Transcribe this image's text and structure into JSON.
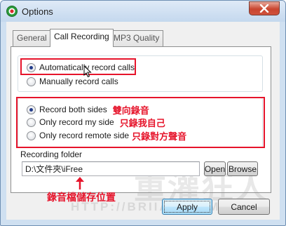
{
  "window": {
    "title": "Options",
    "app_icon": "skype-recorder-icon",
    "close_icon": "close-x-icon"
  },
  "tabs": [
    {
      "label": "General",
      "active": false
    },
    {
      "label": "Call Recording",
      "active": true
    },
    {
      "label": "MP3 Quality",
      "active": false
    }
  ],
  "record_mode": {
    "options": [
      {
        "label": "Automatically record calls",
        "checked": true
      },
      {
        "label": "Manually record calls",
        "checked": false
      }
    ]
  },
  "record_sides": {
    "options": [
      {
        "label": "Record both sides",
        "checked": true,
        "note": "雙向錄音"
      },
      {
        "label": "Only record my side",
        "checked": false,
        "note": "只錄我自己"
      },
      {
        "label": "Only record remote side",
        "checked": false,
        "note": "只錄對方聲音"
      }
    ]
  },
  "folder": {
    "label": "Recording folder",
    "value": "D:\\文件夾\\iFree",
    "open_label": "Open",
    "browse_label": "Browse",
    "note": "錄音檔儲存位置"
  },
  "footer": {
    "apply_label": "Apply",
    "cancel_label": "Cancel"
  },
  "watermark": {
    "text": "重灌狂人",
    "sub": "HTTP://BRIIAN.COM"
  },
  "colors": {
    "annotation": "#e6142b",
    "window_frame": "#cfe0f1",
    "dialog_bg": "#f0f0f0"
  }
}
